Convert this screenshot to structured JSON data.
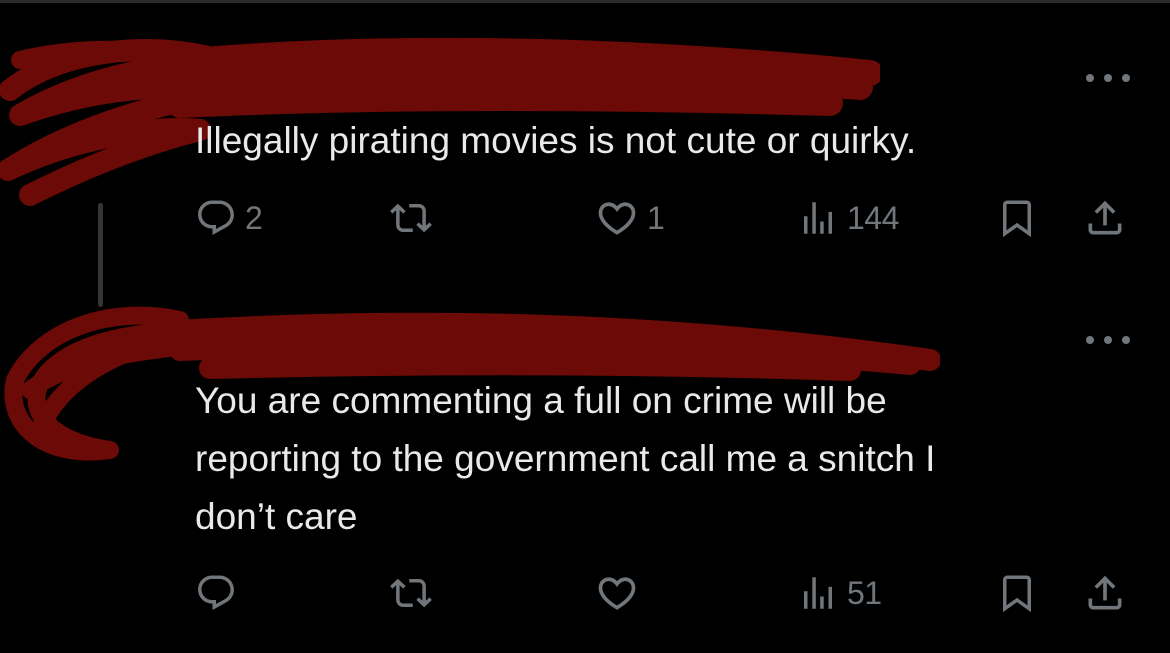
{
  "colors": {
    "background": "#000000",
    "text": "#e7e9ea",
    "icon": "#71767b",
    "redaction": "#6b0a06"
  },
  "tweets": [
    {
      "text": "Illegally pirating movies is not cute or quirky.",
      "reply_count": "2",
      "retweet_count": "",
      "like_count": "1",
      "view_count": "144",
      "icons": [
        "reply-icon",
        "retweet-icon",
        "heart-icon",
        "views-icon",
        "bookmark-icon",
        "share-icon"
      ]
    },
    {
      "text": "You are commenting a full on crime will be\nreporting to the government call me a snitch I\ndon’t care",
      "reply_count": "",
      "retweet_count": "",
      "like_count": "",
      "view_count": "51",
      "icons": [
        "reply-icon",
        "retweet-icon",
        "heart-icon",
        "views-icon",
        "bookmark-icon",
        "share-icon"
      ]
    }
  ]
}
